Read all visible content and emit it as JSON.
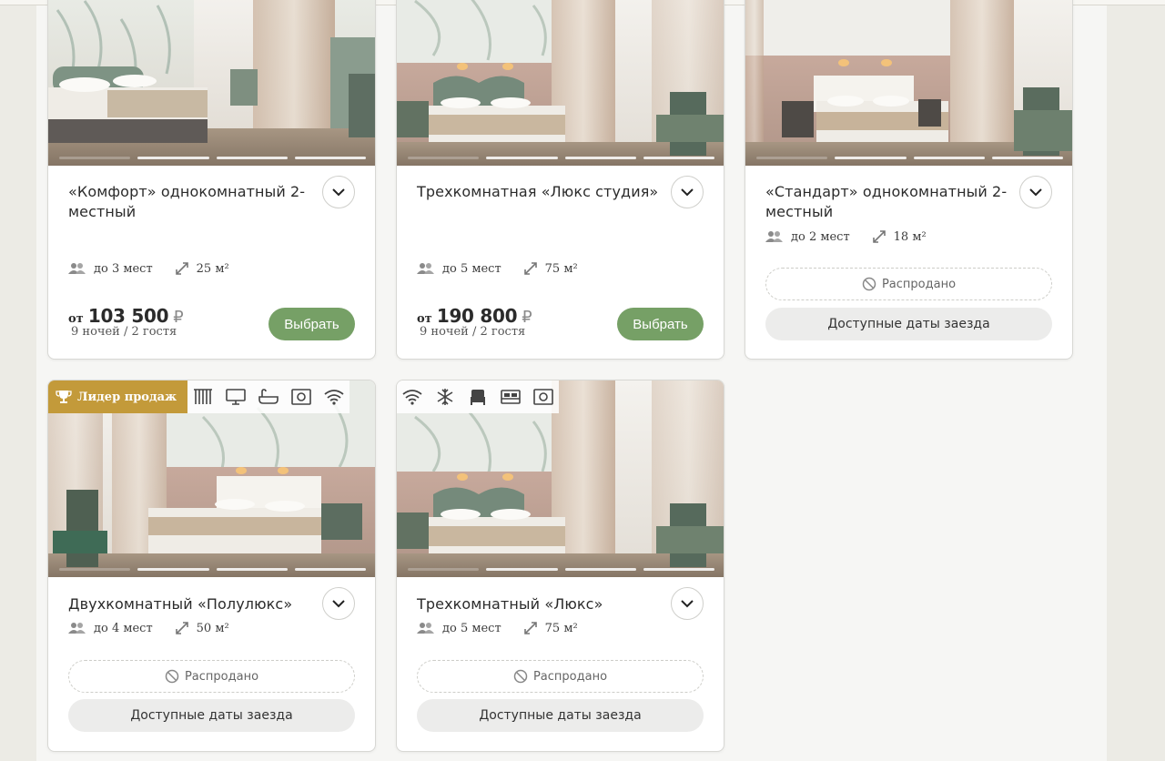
{
  "rooms": [
    {
      "title": "«Комфорт» однокомнатный 2-местный",
      "guests": "до 3 мест",
      "area": "25 м²",
      "price_prefix": "от",
      "price": "103 500",
      "currency": "₽",
      "stay": "9 ночей / 2 гостя",
      "select_label": "Выбрать"
    },
    {
      "title": "Трехкомнатная «Люкс студия»",
      "guests": "до 5 мест",
      "area": "75 м²",
      "price_prefix": "от",
      "price": "190 800",
      "currency": "₽",
      "stay": "9 ночей / 2 гостя",
      "select_label": "Выбрать"
    },
    {
      "title": "«Стандарт» однокомнатный 2-местный",
      "guests": "до 2 мест",
      "area": "18 м²",
      "soldout_label": "Распродано",
      "dates_label": "Доступные даты заезда"
    },
    {
      "badge": "Лидер продаж",
      "amenities": [
        "curtains-icon",
        "tv-icon",
        "bathtub-icon",
        "safe-icon",
        "wifi-icon"
      ],
      "title": "Двухкомнатный «Полулюкс»",
      "guests": "до 4 мест",
      "area": "50 м²",
      "soldout_label": "Распродано",
      "dates_label": "Доступные даты заезда"
    },
    {
      "amenities": [
        "wifi-icon",
        "snowflake-icon",
        "single-bed-icon",
        "double-bed-icon",
        "safe-icon"
      ],
      "title": "Трехкомнатный «Люкс»",
      "guests": "до 5 мест",
      "area": "75 м²",
      "soldout_label": "Распродано",
      "dates_label": "Доступные даты заезда"
    }
  ],
  "colors": {
    "accent_green": "#76a066",
    "badge_gold": "#c39a3a"
  }
}
